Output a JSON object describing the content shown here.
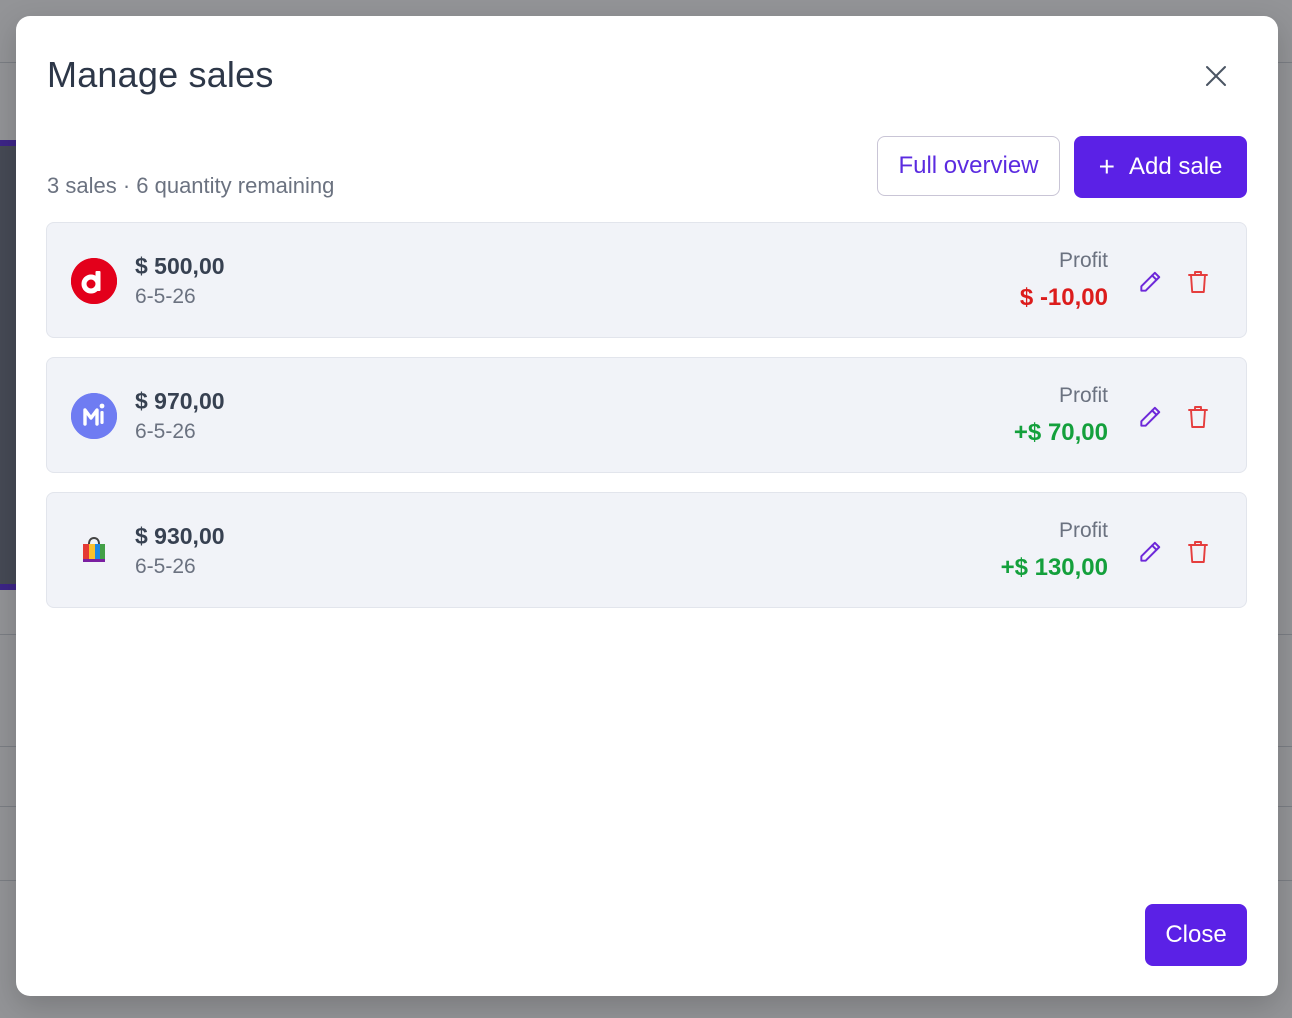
{
  "modal": {
    "title": "Manage sales",
    "summary": "3 sales · 6 quantity remaining",
    "full_overview_label": "Full overview",
    "add_sale_label": "Add sale",
    "add_sale_icon": "+",
    "close_label": "Close"
  },
  "sales": [
    {
      "platform_icon": "red-d-logo",
      "amount": "$ 500,00",
      "date": "6-5-26",
      "profit_label": "Profit",
      "profit": "$ -10,00",
      "profit_color": "#dc1c1c"
    },
    {
      "platform_icon": "blue-m-logo",
      "amount": "$ 970,00",
      "date": "6-5-26",
      "profit_label": "Profit",
      "profit": "+$ 70,00",
      "profit_color": "#14a03c"
    },
    {
      "platform_icon": "shopping-bag-logo",
      "amount": "$ 930,00",
      "date": "6-5-26",
      "profit_label": "Profit",
      "profit": "+$ 130,00",
      "profit_color": "#14a03c"
    }
  ],
  "colors": {
    "accent": "#5b21e6",
    "negative": "#dc1c1c",
    "positive": "#14a03c"
  }
}
